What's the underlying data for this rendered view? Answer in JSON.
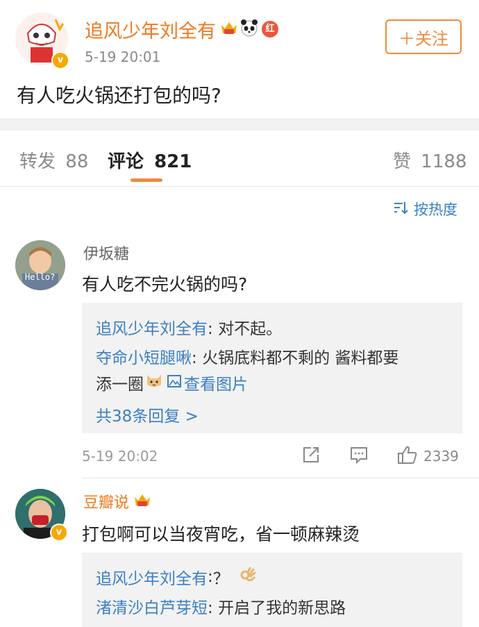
{
  "post": {
    "author": "追风少年刘全有",
    "time": "5-19 20:01",
    "text": "有人吃火锅还打包的吗?",
    "follow_label": "＋关注",
    "badges": [
      "crown-vip-icon",
      "panda-icon",
      "red-badge-icon"
    ],
    "red_badge_text": "红"
  },
  "tabs": {
    "repost_label": "转发",
    "repost_count": "88",
    "comment_label": "评论",
    "comment_count": "821",
    "like_label": "赞",
    "like_count": "1188"
  },
  "sort": {
    "icon": "sort-icon",
    "label": "按热度"
  },
  "comments": [
    {
      "name": "伊坂糖",
      "avatar_text": "Hello?",
      "text": "有人吃不完火锅的吗?",
      "replies": [
        {
          "name": "追风少年刘全有",
          "sep": ": ",
          "text": "对不起。"
        },
        {
          "name": "夺命小短腿啾",
          "sep": ": ",
          "text": "火锅底料都不剩的 酱料都要",
          "text2": "添一圈",
          "image_link": "查看图片"
        }
      ],
      "more": "共38条回复 >",
      "time": "5-19 20:02",
      "like_count": "2339"
    },
    {
      "name": "豆瓣说",
      "text": "打包啊可以当夜宵吃，省一顿麻辣烫",
      "replies": [
        {
          "name": "追风少年刘全有",
          "sep": ":",
          "text": "？"
        },
        {
          "name": "渚清沙白芦芽短",
          "sep": ": ",
          "text": "开启了我的新思路"
        }
      ]
    }
  ],
  "colors": {
    "accent": "#f08a3c",
    "link": "#3b7fc2",
    "name_orange": "#f0781e",
    "gray": "#8a8a8a"
  }
}
